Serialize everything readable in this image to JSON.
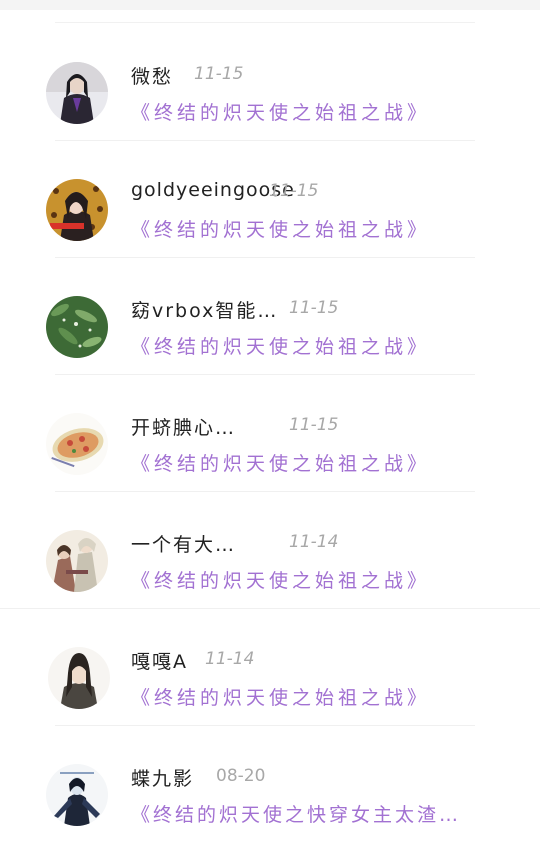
{
  "theme": {
    "accent": "#a271d2",
    "date_color": "#a8a8a8",
    "name_color": "#222222"
  },
  "items": [
    {
      "name": "微愁",
      "date": "11-15",
      "book": "《终结的炽天使之始祖之战》",
      "avatar": "avatar-dark-suit-man"
    },
    {
      "name": "goldyeeingoose",
      "date": "11-15",
      "book": "《终结的炽天使之始祖之战》",
      "avatar": "avatar-girl-leopard-print"
    },
    {
      "name": "窈vrbox智能…",
      "date": "11-15",
      "book": "《终结的炽天使之始祖之战》",
      "avatar": "avatar-green-leaves"
    },
    {
      "name": "开蛴腆心…",
      "date": "11-15",
      "book": "《终结的炽天使之始祖之战》",
      "avatar": "avatar-pizza-plate"
    },
    {
      "name": "一个有大…",
      "date": "11-14",
      "book": "《终结的炽天使之始祖之战》",
      "avatar": "avatar-anime-group"
    },
    {
      "name": "嘎嘎A",
      "date": "11-14",
      "book": "《终结的炽天使之始祖之战》",
      "avatar": "avatar-long-hair-man"
    },
    {
      "name": "蝶九影",
      "date": "08-20",
      "book": "《终结的炽天使之快穿女主太渣…",
      "avatar": "avatar-dark-figure"
    }
  ]
}
